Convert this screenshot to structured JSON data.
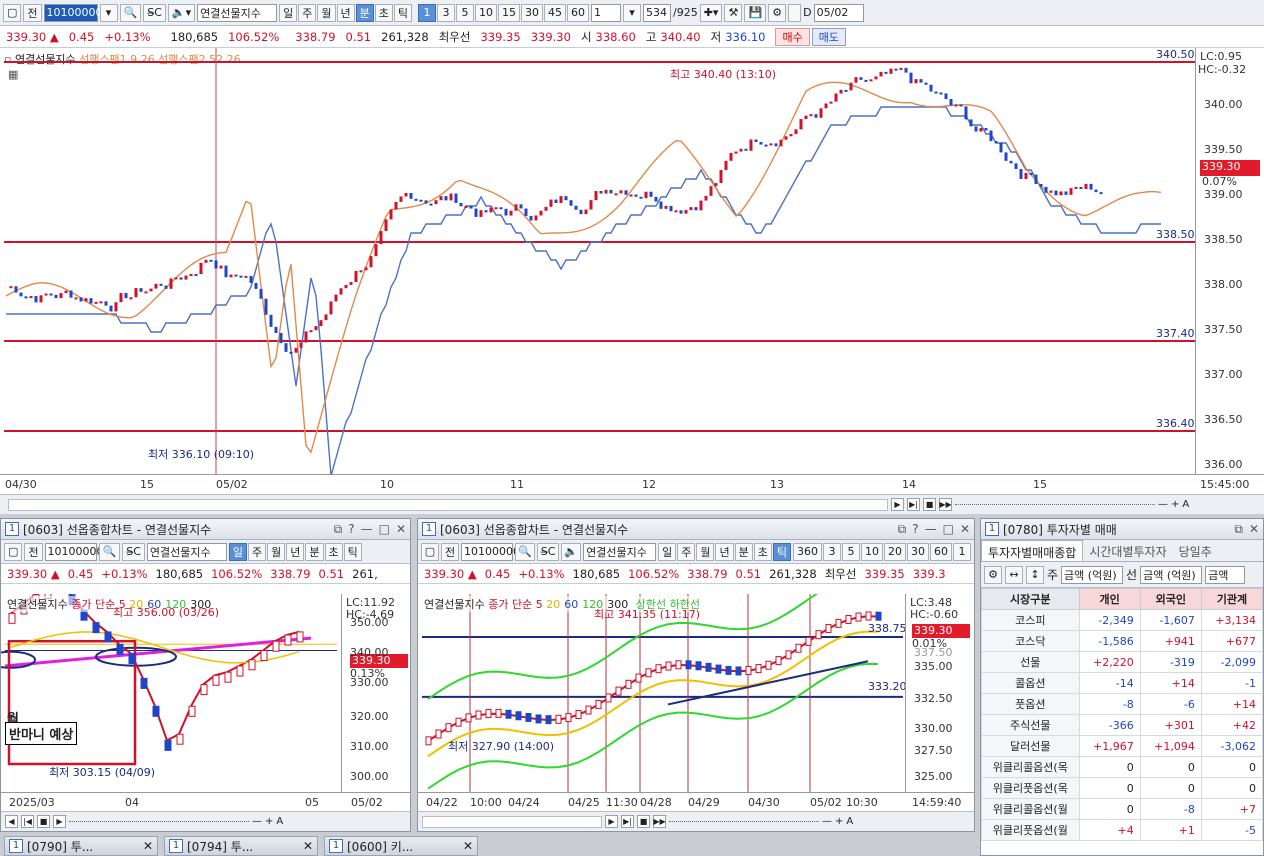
{
  "toolbar": {
    "prev": "전",
    "code": "10100000",
    "name": "연결선물지수",
    "periods": [
      "일",
      "주",
      "월",
      "년",
      "분",
      "초",
      "틱"
    ],
    "active_period": "분",
    "intervals": [
      "1",
      "3",
      "5",
      "10",
      "15",
      "30",
      "45",
      "60"
    ],
    "interval_value": "1",
    "count": "534",
    "count_total": "/925",
    "date_label": "D",
    "date": "05/02"
  },
  "quote": {
    "price": "339.30 ▲",
    "change": "0.45",
    "pct": "+0.13%",
    "volume": "180,685",
    "vol_ratio": "106.52%",
    "basis": "338.79",
    "basis_diff": "0.51",
    "oi": "261,328",
    "best_label": "최우선",
    "ask": "339.35",
    "bid": "339.30",
    "open_label": "시",
    "open": "338.60",
    "high_label": "고",
    "high": "340.40",
    "low_label": "저",
    "low": "336.10",
    "buy": "매수",
    "sell": "매도"
  },
  "main": {
    "legend_name": "연결선물지수",
    "legend_s1": "선행스팬1 9.26",
    "legend_s2": "선행스팬2 52.26",
    "lc": "LC:0.95",
    "hc": "HC:-0.32",
    "last_price": "339.30",
    "last_pct": "0.07%",
    "high_note": "최고 340.40 (13:10)",
    "low_note": "최저 336.10 (09:10)",
    "levels": [
      "340.50",
      "338.50",
      "337.40",
      "336.40"
    ],
    "yticks": [
      "340.00",
      "339.50",
      "339.00",
      "338.50",
      "338.00",
      "337.50",
      "337.00",
      "336.50",
      "336.00"
    ],
    "xticks": [
      "04/30",
      "15",
      "05/02",
      "10",
      "11",
      "12",
      "13",
      "14",
      "15",
      "15:45:00"
    ]
  },
  "sub_left": {
    "title": "[0603] 선옵종합차트 - 연결선물지수",
    "prev": "전",
    "code": "10100000",
    "name": "연결선물지수",
    "periods": [
      "일",
      "주",
      "월",
      "년",
      "분",
      "초",
      "틱"
    ],
    "quote": {
      "price": "339.30 ▲",
      "change": "0.45",
      "pct": "+0.13%",
      "volume": "180,685",
      "vol_ratio": "106.52%",
      "basis": "338.79",
      "basis_diff": "0.51",
      "oi": "261,"
    },
    "legend_name": "연결선물지수",
    "legend_ma": "종가 단순 5",
    "ma_vals": [
      "20",
      "60",
      "120",
      "300"
    ],
    "lc": "LC:11.92",
    "hc": "HC:-4.69",
    "last_price": "339.30",
    "last_pct": "0.13%",
    "high_note": "최고 356.00 (03/26)",
    "low_note": "최저 303.15 (04/09)",
    "annot1": "월",
    "annot2": "반마니 예상",
    "yticks": [
      "350.00",
      "340.00",
      "330.00",
      "320.00",
      "310.00",
      "300.00"
    ],
    "xticks": [
      "2025/03",
      "04",
      "05",
      "05/02"
    ]
  },
  "sub_mid": {
    "title": "[0603] 선옵종합차트 - 연결선물지수",
    "prev": "전",
    "code": "10100000",
    "name": "연결선물지수",
    "periods": [
      "일",
      "주",
      "월",
      "년",
      "분",
      "초",
      "틱"
    ],
    "intervals": [
      "360",
      "3",
      "5",
      "10",
      "20",
      "30",
      "60",
      "1"
    ],
    "quote": {
      "price": "339.30 ▲",
      "change": "0.45",
      "pct": "+0.13%",
      "volume": "180,685",
      "vol_ratio": "106.52%",
      "basis": "338.79",
      "basis_diff": "0.51",
      "oi": "261,328",
      "best_label": "최우선",
      "ask": "339.35",
      "bid": "339.3"
    },
    "legend_name": "연결선물지수",
    "legend_ma": "종가 단순 5",
    "ma_vals": [
      "20",
      "60",
      "120",
      "300"
    ],
    "band_up": "상한선",
    "band_dn": "하한선",
    "lc": "LC:3.48",
    "hc": "HC:-0.60",
    "last_price": "339.30",
    "last_pct": "0.01%",
    "lvl1": "338.75",
    "lvl2": "333.20",
    "high_note": "최고 341.35 (11:17)",
    "low_note": "최저 327.90 (14:00)",
    "yticks": [
      "335.00",
      "332.50",
      "330.00",
      "327.50",
      "325.00"
    ],
    "ytick_top": "337.50",
    "xticks": [
      "04/22",
      "10:00",
      "04/24",
      "04/25",
      "11:30",
      "04/28",
      "04/29",
      "04/30",
      "05/02",
      "10:30",
      "14:59:40"
    ]
  },
  "investor": {
    "title": "[0780] 투자자별 매매",
    "tabs": [
      "투자자별매매종합",
      "시간대별투자자",
      "당일추"
    ],
    "sort_label": "주",
    "sel1": "금액 (억원)",
    "sel_label": "선",
    "sel2": "금액 (억원)",
    "sel3": "금액",
    "headers": [
      "시장구분",
      "개인",
      "외국인",
      "기관계"
    ],
    "rows": [
      {
        "name": "코스피",
        "v": [
          "-2,349",
          "-1,607",
          "+3,134"
        ]
      },
      {
        "name": "코스닥",
        "v": [
          "-1,586",
          "+941",
          "+677"
        ]
      },
      {
        "name": "선물",
        "v": [
          "+2,220",
          "-319",
          "-2,099"
        ]
      },
      {
        "name": "콜옵션",
        "v": [
          "-14",
          "+14",
          "-1"
        ]
      },
      {
        "name": "풋옵션",
        "v": [
          "-8",
          "-6",
          "+14"
        ]
      },
      {
        "name": "주식선물",
        "v": [
          "-366",
          "+301",
          "+42"
        ]
      },
      {
        "name": "달러선물",
        "v": [
          "+1,967",
          "+1,094",
          "-3,062"
        ]
      },
      {
        "name": "위클리콜옵션(목",
        "v": [
          "0",
          "0",
          "0"
        ]
      },
      {
        "name": "위클리풋옵션(목",
        "v": [
          "0",
          "0",
          "0"
        ]
      },
      {
        "name": "위클리콜옵션(월",
        "v": [
          "0",
          "-8",
          "+7"
        ]
      },
      {
        "name": "위클리풋옵션(월",
        "v": [
          "+4",
          "+1",
          "-5"
        ]
      }
    ]
  },
  "taskbar": [
    {
      "label": "[0790] 투..."
    },
    {
      "label": "[0794] 투..."
    },
    {
      "label": "[0600] 키..."
    }
  ],
  "colors": {
    "up": "#d0112b",
    "down": "#1f46c8",
    "span1": "#e08a4a",
    "span2": "#4a72c9",
    "level": "#d0112b"
  }
}
